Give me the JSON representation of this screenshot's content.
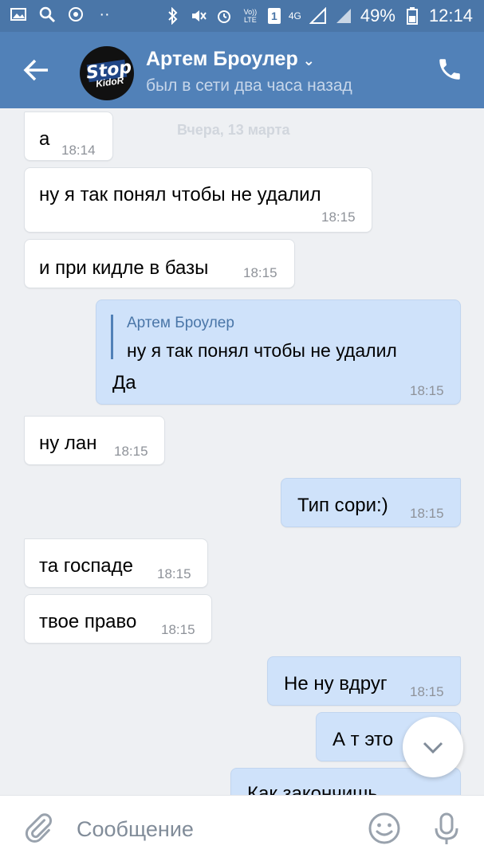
{
  "status_bar": {
    "battery": "49%",
    "time": "12:14",
    "volte": "Vo)) LTE",
    "sim": "1",
    "network": "4G"
  },
  "header": {
    "contact_name": "Артем Броулер",
    "presence": "был в сети два часа назад",
    "avatar_text_1": "Stop",
    "avatar_text_2": "KidoR"
  },
  "feed": {
    "date_separator": "Вчера, 13 марта",
    "messages": [
      {
        "dir": "in",
        "text": "а",
        "time": "18:14"
      },
      {
        "dir": "in",
        "text": "ну я так понял чтобы не удалил",
        "time": "18:15"
      },
      {
        "dir": "in",
        "text": "и при кидле в базы",
        "time": "18:15"
      },
      {
        "dir": "out",
        "quote_author": "Артем Броулер",
        "quote_text": "ну я так понял чтобы не удалил",
        "text": "Да",
        "time": "18:15"
      },
      {
        "dir": "in",
        "text": "ну лан",
        "time": "18:15"
      },
      {
        "dir": "out",
        "text": "Тип сори:)",
        "time": "18:15"
      },
      {
        "dir": "in",
        "text": "та госпаде",
        "time": "18:15"
      },
      {
        "dir": "in",
        "text": "твое право",
        "time": "18:15"
      },
      {
        "dir": "out",
        "text": "Не ну вдруг",
        "time": "18:15"
      },
      {
        "dir": "out",
        "text": "А т это",
        "time": ""
      },
      {
        "dir": "out",
        "text": "Как закончишь",
        "time": ""
      }
    ]
  },
  "composer": {
    "placeholder": "Сообщение"
  },
  "colors": {
    "header_bg": "#5181b8",
    "statusbar_bg": "#4a76a8",
    "incoming_bubble": "#ffffff",
    "outgoing_bubble": "#cfe2fa",
    "feed_bg": "#eef0f3"
  }
}
